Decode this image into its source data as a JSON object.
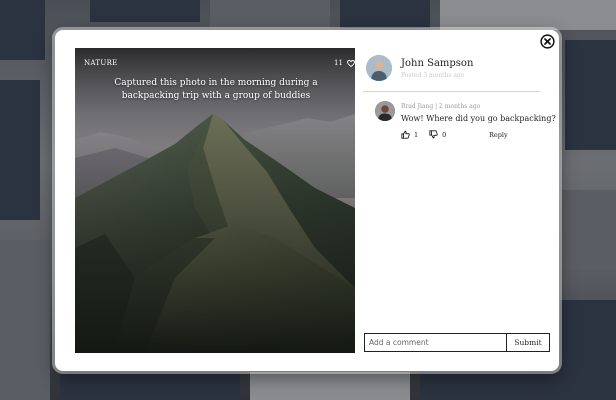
{
  "post": {
    "category": "NATURE",
    "like_count": "11",
    "caption": "Captured this photo in the morning during a backpacking trip with a group of buddies",
    "author_name": "John Sampson",
    "posted": "Posted 3 months ago"
  },
  "comments": [
    {
      "meta": "Brad Jiang | 2 months ago",
      "text": "Wow! Where did you go backpacking?",
      "likes": "1",
      "dislikes": "0",
      "reply_label": "Reply"
    }
  ],
  "comment_form": {
    "placeholder": "Add a comment",
    "submit_label": "Submit"
  },
  "icons": {
    "close": "close-icon",
    "heart": "heart-icon",
    "thumbs_up": "thumbs-up-icon",
    "thumbs_down": "thumbs-down-icon"
  }
}
